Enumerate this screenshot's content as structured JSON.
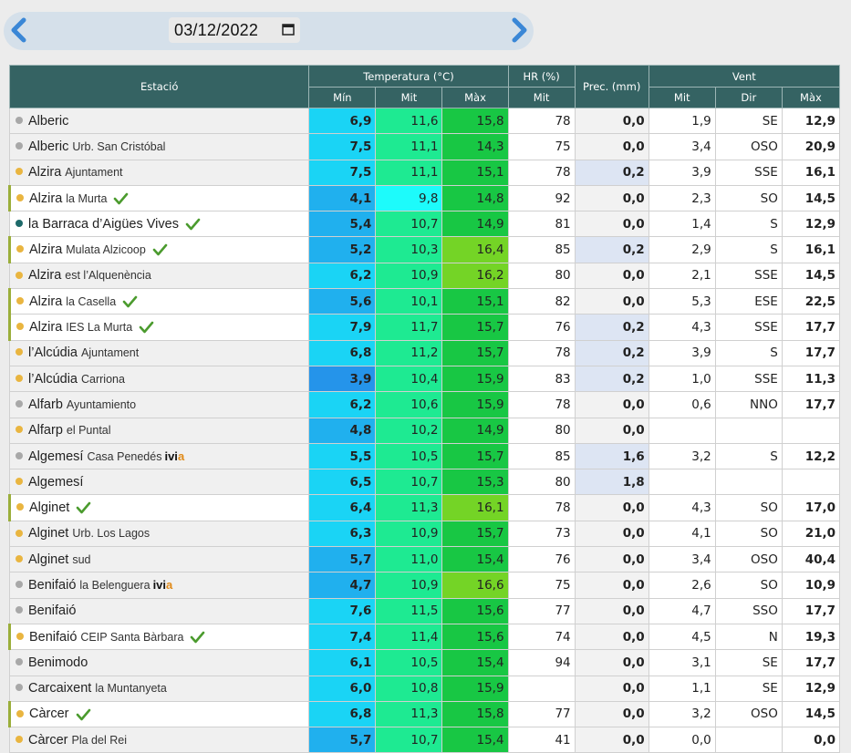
{
  "date": {
    "value": "03/12/2022"
  },
  "icons": {
    "prev": "chevron-left-icon",
    "next": "chevron-right-icon",
    "calendar": "calendar-icon",
    "check": "check-icon"
  },
  "colors": {
    "dot_gray": "#a8a8a8",
    "dot_yellow": "#e9b540",
    "dot_teal": "#1e6a6a",
    "header_bg": "#356363",
    "check": "#4b9b2e",
    "ivia_accent": "#e08a18"
  },
  "headers": {
    "station": "Estació",
    "temp": "Temperatura (°C)",
    "hr": "HR (%)",
    "prec": "Prec. (mm)",
    "wind": "Vent",
    "temp_min": "Mín",
    "temp_mit": "Mit",
    "temp_max": "Màx",
    "hr_mit": "Mit",
    "wind_mit": "Mit",
    "wind_dir": "Dir",
    "wind_max": "Màx"
  },
  "rows": [
    {
      "name": "Alberic",
      "sub": "",
      "dot": "gray",
      "check": false,
      "ivia": false,
      "min": "6,9",
      "mit": "11,6",
      "max": "15,8",
      "hr": "78",
      "prec": "0,0",
      "wmit": "1,9",
      "wdir": "SE",
      "wmax": "12,9",
      "minc": "#1ad4f5",
      "mitc": "#1eea92",
      "maxc": "#18c744",
      "precc": "grey",
      "bar": false,
      "white": false
    },
    {
      "name": "Alberic",
      "sub": "Urb. San Cristóbal",
      "dot": "gray",
      "check": false,
      "ivia": false,
      "min": "7,5",
      "mit": "11,1",
      "max": "14,3",
      "hr": "75",
      "prec": "0,0",
      "wmit": "3,4",
      "wdir": "OSO",
      "wmax": "20,9",
      "minc": "#1ad4f5",
      "mitc": "#1eea92",
      "maxc": "#18c744",
      "precc": "grey",
      "bar": false,
      "white": false
    },
    {
      "name": "Alzira",
      "sub": "Ajuntament",
      "dot": "yellow",
      "check": false,
      "ivia": false,
      "min": "7,5",
      "mit": "11,1",
      "max": "15,1",
      "hr": "78",
      "prec": "0,2",
      "wmit": "3,9",
      "wdir": "SSE",
      "wmax": "16,1",
      "minc": "#1ad4f5",
      "mitc": "#1eea92",
      "maxc": "#18c744",
      "precc": "blue",
      "bar": false,
      "white": false
    },
    {
      "name": "Alzira",
      "sub": "la Murta",
      "dot": "yellow",
      "check": true,
      "ivia": false,
      "min": "4,1",
      "mit": "9,8",
      "max": "14,8",
      "hr": "92",
      "prec": "0,0",
      "wmit": "2,3",
      "wdir": "SO",
      "wmax": "14,5",
      "minc": "#20b0ee",
      "mitc": "#1dfbfb",
      "maxc": "#18c744",
      "precc": "grey",
      "bar": true,
      "white": true
    },
    {
      "name": "la Barraca d’Aigües Vives",
      "sub": "",
      "dot": "teal",
      "check": true,
      "ivia": false,
      "min": "5,4",
      "mit": "10,7",
      "max": "14,9",
      "hr": "81",
      "prec": "0,0",
      "wmit": "1,4",
      "wdir": "S",
      "wmax": "12,9",
      "minc": "#20b0ee",
      "mitc": "#1eea92",
      "maxc": "#18c744",
      "precc": "grey",
      "bar": false,
      "white": true
    },
    {
      "name": "Alzira",
      "sub": "Mulata Alzicoop",
      "dot": "yellow",
      "check": true,
      "ivia": false,
      "min": "5,2",
      "mit": "10,3",
      "max": "16,4",
      "hr": "85",
      "prec": "0,2",
      "wmit": "2,9",
      "wdir": "S",
      "wmax": "16,1",
      "minc": "#20b0ee",
      "mitc": "#1eea92",
      "maxc": "#74d426",
      "precc": "blue",
      "bar": true,
      "white": true
    },
    {
      "name": "Alzira",
      "sub": "est l’Alquenència",
      "dot": "yellow",
      "check": false,
      "ivia": false,
      "min": "6,2",
      "mit": "10,9",
      "max": "16,2",
      "hr": "80",
      "prec": "0,0",
      "wmit": "2,1",
      "wdir": "SSE",
      "wmax": "14,5",
      "minc": "#1ad4f5",
      "mitc": "#1eea92",
      "maxc": "#74d426",
      "precc": "grey",
      "bar": false,
      "white": false
    },
    {
      "name": "Alzira",
      "sub": "la Casella",
      "dot": "yellow",
      "check": true,
      "ivia": false,
      "min": "5,6",
      "mit": "10,1",
      "max": "15,1",
      "hr": "82",
      "prec": "0,0",
      "wmit": "5,3",
      "wdir": "ESE",
      "wmax": "22,5",
      "minc": "#20b0ee",
      "mitc": "#1eea92",
      "maxc": "#18c744",
      "precc": "grey",
      "bar": true,
      "white": true
    },
    {
      "name": "Alzira",
      "sub": "IES La Murta",
      "dot": "yellow",
      "check": true,
      "ivia": false,
      "min": "7,9",
      "mit": "11,7",
      "max": "15,7",
      "hr": "76",
      "prec": "0,2",
      "wmit": "4,3",
      "wdir": "SSE",
      "wmax": "17,7",
      "minc": "#1ad4f5",
      "mitc": "#1eea92",
      "maxc": "#18c744",
      "precc": "blue",
      "bar": true,
      "white": true
    },
    {
      "name": "l’Alcúdia",
      "sub": "Ajuntament",
      "dot": "yellow",
      "check": false,
      "ivia": false,
      "min": "6,8",
      "mit": "11,2",
      "max": "15,7",
      "hr": "78",
      "prec": "0,2",
      "wmit": "3,9",
      "wdir": "S",
      "wmax": "17,7",
      "minc": "#1ad4f5",
      "mitc": "#1eea92",
      "maxc": "#18c744",
      "precc": "blue",
      "bar": false,
      "white": false
    },
    {
      "name": "l’Alcúdia",
      "sub": "Carriona",
      "dot": "yellow",
      "check": false,
      "ivia": false,
      "min": "3,9",
      "mit": "10,4",
      "max": "15,9",
      "hr": "83",
      "prec": "0,2",
      "wmit": "1,0",
      "wdir": "SSE",
      "wmax": "11,3",
      "minc": "#2594ea",
      "mitc": "#1eea92",
      "maxc": "#18c744",
      "precc": "blue",
      "bar": false,
      "white": false
    },
    {
      "name": "Alfarb",
      "sub": "Ayuntamiento",
      "dot": "gray",
      "check": false,
      "ivia": false,
      "min": "6,2",
      "mit": "10,6",
      "max": "15,9",
      "hr": "78",
      "prec": "0,0",
      "wmit": "0,6",
      "wdir": "NNO",
      "wmax": "17,7",
      "minc": "#1ad4f5",
      "mitc": "#1eea92",
      "maxc": "#18c744",
      "precc": "grey",
      "bar": false,
      "white": false
    },
    {
      "name": "Alfarp",
      "sub": "el Puntal",
      "dot": "yellow",
      "check": false,
      "ivia": false,
      "min": "4,8",
      "mit": "10,2",
      "max": "14,9",
      "hr": "80",
      "prec": "0,0",
      "wmit": "",
      "wdir": "",
      "wmax": "",
      "minc": "#20b0ee",
      "mitc": "#1eea92",
      "maxc": "#18c744",
      "precc": "grey",
      "bar": false,
      "white": false
    },
    {
      "name": "Algemesí",
      "sub": "Casa Penedés",
      "dot": "gray",
      "check": false,
      "ivia": true,
      "min": "5,5",
      "mit": "10,5",
      "max": "15,7",
      "hr": "85",
      "prec": "1,6",
      "wmit": "3,2",
      "wdir": "S",
      "wmax": "12,2",
      "minc": "#1ad4f5",
      "mitc": "#1eea92",
      "maxc": "#18c744",
      "precc": "blue",
      "bar": false,
      "white": false
    },
    {
      "name": "Algemesí",
      "sub": "",
      "dot": "yellow",
      "check": false,
      "ivia": false,
      "min": "6,5",
      "mit": "10,7",
      "max": "15,3",
      "hr": "80",
      "prec": "1,8",
      "wmit": "",
      "wdir": "",
      "wmax": "",
      "minc": "#1ad4f5",
      "mitc": "#1eea92",
      "maxc": "#18c744",
      "precc": "blue",
      "bar": false,
      "white": false
    },
    {
      "name": "Alginet",
      "sub": "",
      "dot": "yellow",
      "check": true,
      "ivia": false,
      "min": "6,4",
      "mit": "11,3",
      "max": "16,1",
      "hr": "78",
      "prec": "0,0",
      "wmit": "4,3",
      "wdir": "SO",
      "wmax": "17,0",
      "minc": "#1ad4f5",
      "mitc": "#1eea92",
      "maxc": "#74d426",
      "precc": "grey",
      "bar": true,
      "white": true
    },
    {
      "name": "Alginet",
      "sub": "Urb. Los Lagos",
      "dot": "yellow",
      "check": false,
      "ivia": false,
      "min": "6,3",
      "mit": "10,9",
      "max": "15,7",
      "hr": "73",
      "prec": "0,0",
      "wmit": "4,1",
      "wdir": "SO",
      "wmax": "21,0",
      "minc": "#1ad4f5",
      "mitc": "#1eea92",
      "maxc": "#18c744",
      "precc": "grey",
      "bar": false,
      "white": false
    },
    {
      "name": "Alginet",
      "sub": "sud",
      "dot": "yellow",
      "check": false,
      "ivia": false,
      "min": "5,7",
      "mit": "11,0",
      "max": "15,4",
      "hr": "76",
      "prec": "0,0",
      "wmit": "3,4",
      "wdir": "OSO",
      "wmax": "40,4",
      "minc": "#20b0ee",
      "mitc": "#1eea92",
      "maxc": "#18c744",
      "precc": "grey",
      "bar": false,
      "white": false
    },
    {
      "name": "Benifaió",
      "sub": "la Belenguera",
      "dot": "gray",
      "check": false,
      "ivia": true,
      "min": "4,7",
      "mit": "10,9",
      "max": "16,6",
      "hr": "75",
      "prec": "0,0",
      "wmit": "2,6",
      "wdir": "SO",
      "wmax": "10,9",
      "minc": "#20b0ee",
      "mitc": "#1eea92",
      "maxc": "#74d426",
      "precc": "grey",
      "bar": false,
      "white": false
    },
    {
      "name": "Benifaió",
      "sub": "",
      "dot": "gray",
      "check": false,
      "ivia": false,
      "min": "7,6",
      "mit": "11,5",
      "max": "15,6",
      "hr": "77",
      "prec": "0,0",
      "wmit": "4,7",
      "wdir": "SSO",
      "wmax": "17,7",
      "minc": "#1ad4f5",
      "mitc": "#1eea92",
      "maxc": "#18c744",
      "precc": "grey",
      "bar": false,
      "white": false
    },
    {
      "name": "Benifaió",
      "sub": "CEIP Santa Bàrbara",
      "dot": "yellow",
      "check": true,
      "ivia": false,
      "min": "7,4",
      "mit": "11,4",
      "max": "15,6",
      "hr": "74",
      "prec": "0,0",
      "wmit": "4,5",
      "wdir": "N",
      "wmax": "19,3",
      "minc": "#1ad4f5",
      "mitc": "#1eea92",
      "maxc": "#18c744",
      "precc": "grey",
      "bar": true,
      "white": true
    },
    {
      "name": "Benimodo",
      "sub": "",
      "dot": "gray",
      "check": false,
      "ivia": false,
      "min": "6,1",
      "mit": "10,5",
      "max": "15,4",
      "hr": "94",
      "prec": "0,0",
      "wmit": "3,1",
      "wdir": "SE",
      "wmax": "17,7",
      "minc": "#1ad4f5",
      "mitc": "#1eea92",
      "maxc": "#18c744",
      "precc": "grey",
      "bar": false,
      "white": false
    },
    {
      "name": "Carcaixent",
      "sub": "la Muntanyeta",
      "dot": "gray",
      "check": false,
      "ivia": false,
      "min": "6,0",
      "mit": "10,8",
      "max": "15,9",
      "hr": "",
      "prec": "0,0",
      "wmit": "1,1",
      "wdir": "SE",
      "wmax": "12,9",
      "minc": "#1ad4f5",
      "mitc": "#1eea92",
      "maxc": "#18c744",
      "precc": "grey",
      "bar": false,
      "white": false
    },
    {
      "name": "Càrcer",
      "sub": "",
      "dot": "yellow",
      "check": true,
      "ivia": false,
      "min": "6,8",
      "mit": "11,3",
      "max": "15,8",
      "hr": "77",
      "prec": "0,0",
      "wmit": "3,2",
      "wdir": "OSO",
      "wmax": "14,5",
      "minc": "#1ad4f5",
      "mitc": "#1eea92",
      "maxc": "#18c744",
      "precc": "grey",
      "bar": true,
      "white": true
    },
    {
      "name": "Càrcer",
      "sub": "Pla del Rei",
      "dot": "yellow",
      "check": false,
      "ivia": false,
      "min": "5,7",
      "mit": "10,7",
      "max": "15,4",
      "hr": "41",
      "prec": "0,0",
      "wmit": "0,0",
      "wdir": "",
      "wmax": "0,0",
      "minc": "#20b0ee",
      "mitc": "#1eea92",
      "maxc": "#18c744",
      "precc": "grey",
      "bar": false,
      "white": false
    }
  ]
}
